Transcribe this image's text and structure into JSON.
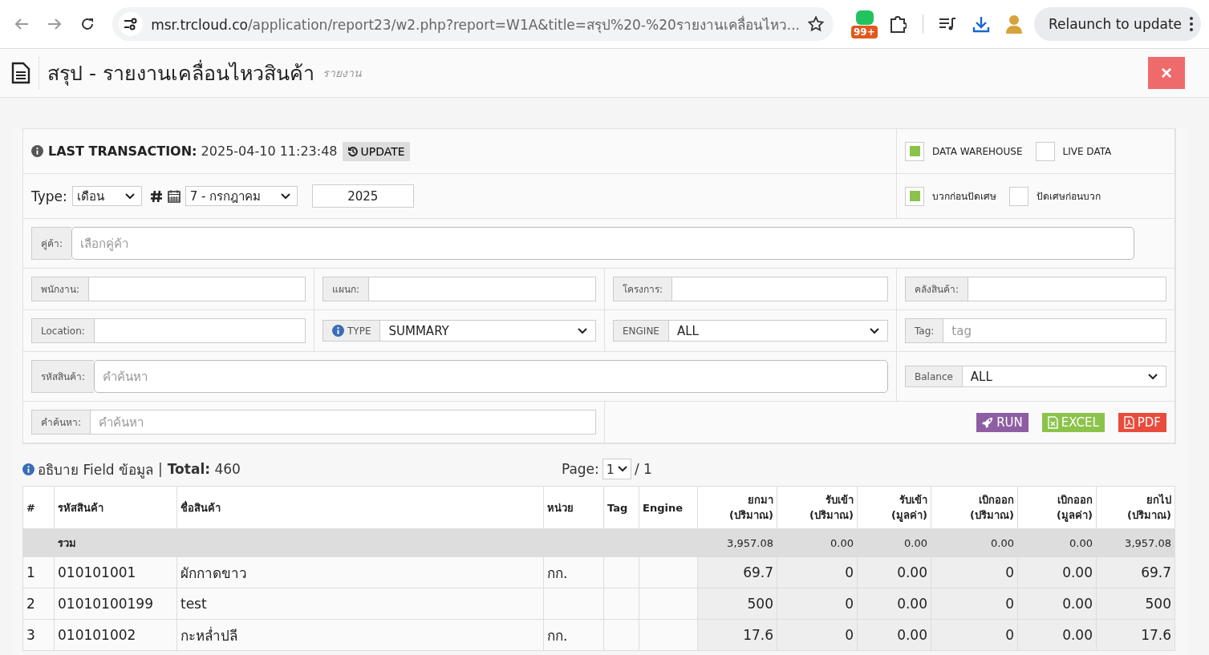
{
  "browser": {
    "url_host": "msr.trcloud.co",
    "url_path": "/application/report23/w2.php?report=W1A&title=สรุป%20-%20รายงานเคลื่อนไหว...",
    "extension_badge": "99+",
    "relaunch": "Relaunch to update"
  },
  "header": {
    "title": "สรุป - รายงานเคลื่อนไหวสินค้า",
    "subtitle": "รายงาน",
    "close": "×"
  },
  "last_transaction": {
    "label": "LAST TRANSACTION:",
    "value": "2025-04-10 11:23:48",
    "button": "UPDATE"
  },
  "sources": [
    {
      "label": "DATA WAREHOUSE",
      "checked": true
    },
    {
      "label": "LIVE DATA",
      "checked": false
    }
  ],
  "rounding": [
    {
      "label": "บวกก่อนปัดเศษ",
      "checked": true
    },
    {
      "label": "ปัดเศษก่อนบวก",
      "checked": false
    }
  ],
  "period": {
    "type_label": "Type:",
    "type_value": "เดือน",
    "month": "7 - กรกฎาคม",
    "year": "2025"
  },
  "filter_rows": [
    [
      {
        "kind": "wide",
        "label": "คู่ค้า:",
        "placeholder": "เลือกคู่ค้า"
      }
    ],
    [
      {
        "kind": "input",
        "label": "พนักงาน:"
      },
      {
        "kind": "input",
        "label": "แผนก:"
      },
      {
        "kind": "input",
        "label": "โครงการ:"
      },
      {
        "kind": "input",
        "label": "คลังสินค้า:"
      }
    ],
    [
      {
        "kind": "input",
        "label": "Location:"
      },
      {
        "kind": "select",
        "label": "TYPE",
        "info": true,
        "value": "SUMMARY"
      },
      {
        "kind": "select",
        "label": "ENGINE",
        "value": "ALL"
      },
      {
        "kind": "input",
        "label": "Tag:",
        "placeholder": "tag"
      }
    ],
    [
      {
        "kind": "wide",
        "label": "รหัสสินค้า:",
        "placeholder": "คำค้นหา"
      },
      {
        "kind": "select",
        "label": "Balance",
        "value": "ALL"
      }
    ],
    [
      {
        "kind": "input",
        "label": "คำค้นหา:",
        "placeholder": "คำค้นหา"
      },
      {
        "kind": "actions"
      }
    ]
  ],
  "actions": [
    {
      "kind": "run",
      "label": "RUN"
    },
    {
      "kind": "excel",
      "label": "EXCEL"
    },
    {
      "kind": "pdf",
      "label": "PDF"
    }
  ],
  "summary": {
    "info": "อธิบาย Field ข้อมูล",
    "separator": "|",
    "total_label": "Total:",
    "total": "460",
    "page_label": "Page:",
    "page": "1",
    "page_count": "/ 1"
  },
  "table": {
    "columns": [
      {
        "kind": "text",
        "lines": [
          "#"
        ]
      },
      {
        "kind": "text",
        "lines": [
          "รหัสสินค้า"
        ]
      },
      {
        "kind": "text",
        "lines": [
          "ชื่อสินค้า"
        ]
      },
      {
        "kind": "text",
        "lines": [
          "หน่วย"
        ]
      },
      {
        "kind": "text",
        "lines": [
          "Tag"
        ]
      },
      {
        "kind": "text",
        "lines": [
          "Engine"
        ]
      },
      {
        "kind": "number",
        "lines": [
          "ยกมา",
          "(ปริมาณ)"
        ]
      },
      {
        "kind": "number",
        "lines": [
          "รับเข้า",
          "(ปริมาณ)"
        ]
      },
      {
        "kind": "number",
        "lines": [
          "รับเข้า",
          "(มูลค่า)"
        ]
      },
      {
        "kind": "number",
        "lines": [
          "เบิกออก",
          "(ปริมาณ)"
        ]
      },
      {
        "kind": "number",
        "lines": [
          "เบิกออก",
          "(มูลค่า)"
        ]
      },
      {
        "kind": "number",
        "lines": [
          "ยกไป",
          "(ปริมาณ)"
        ]
      }
    ],
    "total_row": {
      "label": "รวม",
      "values": [
        "3,957.08",
        "0.00",
        "0.00",
        "0.00",
        "0.00",
        "3,957.08"
      ]
    },
    "rows": [
      {
        "cells": [
          "1",
          "010101001",
          "ผักกาดขาว",
          "กก.",
          "",
          "",
          "69.7",
          "0",
          "0.00",
          "0",
          "0.00",
          "69.7"
        ]
      },
      {
        "cells": [
          "2",
          "01010100199",
          "test",
          "",
          "",
          "",
          "500",
          "0",
          "0.00",
          "0",
          "0.00",
          "500"
        ]
      },
      {
        "cells": [
          "3",
          "010101002",
          "กะหล่ำปลี",
          "กก.",
          "",
          "",
          "17.6",
          "0",
          "0.00",
          "0",
          "0.00",
          "17.6"
        ]
      }
    ]
  }
}
